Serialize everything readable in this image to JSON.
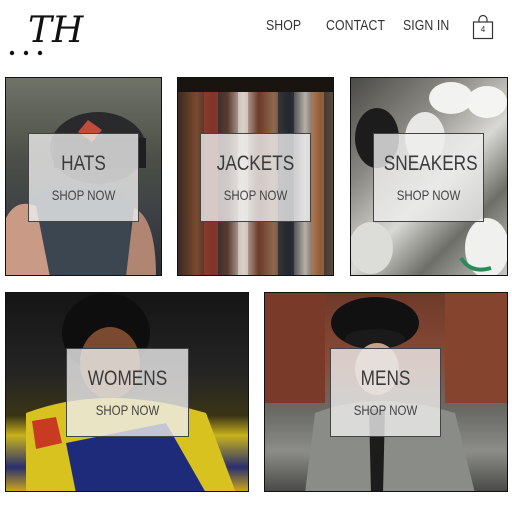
{
  "header": {
    "logo_text": "TH",
    "nav": {
      "shop": "SHOP",
      "contact": "CONTACT",
      "sign_in": "SIGN IN"
    },
    "cart": {
      "icon": "shopping-bag-icon",
      "count": "4"
    }
  },
  "categories": [
    {
      "title": "HATS",
      "cta": "SHOP NOW"
    },
    {
      "title": "JACKETS",
      "cta": "SHOP NOW"
    },
    {
      "title": "SNEAKERS",
      "cta": "SHOP NOW"
    },
    {
      "title": "WOMENS",
      "cta": "SHOP NOW"
    },
    {
      "title": "MENS",
      "cta": "SHOP NOW"
    }
  ],
  "colors": {
    "background": "#ffffff",
    "text": "#333333",
    "label_overlay": "#eeeeee"
  }
}
